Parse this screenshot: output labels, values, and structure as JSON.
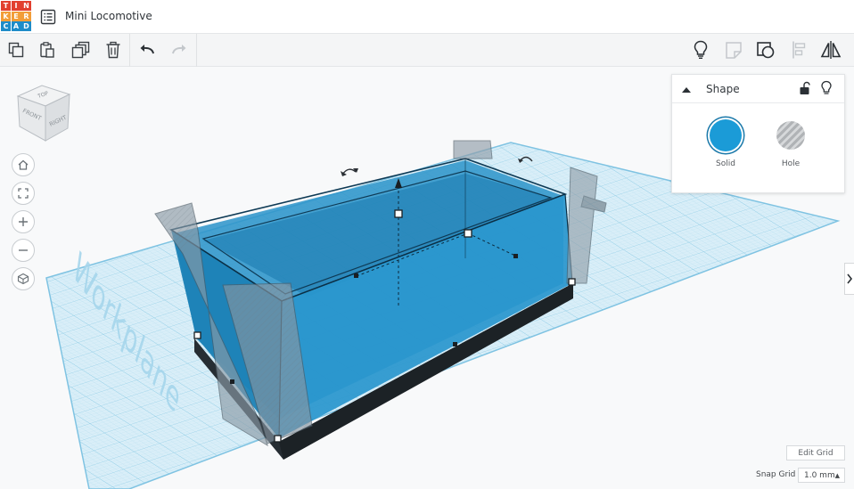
{
  "app": {
    "logo_letters": [
      "T",
      "I",
      "N",
      "K",
      "E",
      "R",
      "C",
      "A",
      "D"
    ],
    "logo_colors": [
      "#e2402f",
      "#e2402f",
      "#e2402f",
      "#f29d38",
      "#f29d38",
      "#f29d38",
      "#1e8cc8",
      "#1e8cc8",
      "#1e8cc8"
    ],
    "title": "Mini Locomotive"
  },
  "toolbar": {
    "left_icons": [
      "copy-icon",
      "paste-icon",
      "duplicate-icon",
      "trash-icon",
      "undo-icon",
      "redo-icon"
    ],
    "right_icons": [
      "lightbulb-icon",
      "notes-icon",
      "group-icon",
      "align-icon",
      "mirror-icon"
    ]
  },
  "viewcube": {
    "top": "TOP",
    "front": "FRONT",
    "right": "RIGHT"
  },
  "view_controls": [
    "home-icon",
    "fit-view-icon",
    "zoom-in-icon",
    "zoom-out-icon",
    "perspective-icon"
  ],
  "workplane": {
    "label": "Workplane"
  },
  "shape_panel": {
    "title": "Shape",
    "solid_label": "Solid",
    "hole_label": "Hole",
    "solid_color": "#1b9bd7"
  },
  "grid": {
    "edit_grid_label": "Edit Grid",
    "snap_grid_label": "Snap Grid",
    "snap_value": "1.0 mm"
  },
  "colors": {
    "shape_fill": "#1f8fc6",
    "grid_line": "#9fd3ea",
    "base_dark": "#232a30"
  }
}
